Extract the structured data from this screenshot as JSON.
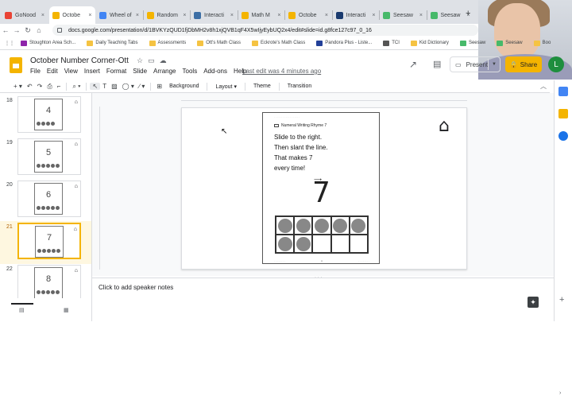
{
  "tabs": [
    {
      "label": "GoNood",
      "favicon": "#e94335",
      "active": false
    },
    {
      "label": "Octobe",
      "favicon": "#f4b400",
      "active": true
    },
    {
      "label": "Wheel of",
      "favicon": "#4285f4",
      "active": false
    },
    {
      "label": "Random",
      "favicon": "#f4b400",
      "active": false
    },
    {
      "label": "Interacti",
      "favicon": "#3c6ea5",
      "active": false
    },
    {
      "label": "Math M",
      "favicon": "#f4b400",
      "active": false
    },
    {
      "label": "Octobe",
      "favicon": "#f4b400",
      "active": false
    },
    {
      "label": "Interacti",
      "favicon": "#1a3a6e",
      "active": false
    },
    {
      "label": "Seesaw",
      "favicon": "#47b96a",
      "active": false
    },
    {
      "label": "Seesaw",
      "favicon": "#47b96a",
      "active": false
    }
  ],
  "close_glyph": "×",
  "new_tab_glyph": "+",
  "address": {
    "url": "docs.google.com/presentation/d/1BVKYzQUD1fjDbMH2v8h1xjQVB1qF4X5wIjyEybUQ2x4/edit#slide=id.g8fce127c97_0_16"
  },
  "bookmarks": [
    {
      "label": "Stoughton Area Sch...",
      "color": "#8e24aa"
    },
    {
      "label": "Daily Teaching Tabs",
      "color": "#f5c342"
    },
    {
      "label": "Assessments",
      "color": "#f5c342"
    },
    {
      "label": "Ott's Math Class",
      "color": "#f5c342"
    },
    {
      "label": "Eckrote's Math Class",
      "color": "#f5c342"
    },
    {
      "label": "Pandora Plus - Liste...",
      "color": "#224099"
    },
    {
      "label": "TCI",
      "color": "#555555"
    },
    {
      "label": "Kid Dictionary",
      "color": "#f5c342"
    },
    {
      "label": "Seesaw",
      "color": "#47b96a"
    },
    {
      "label": "Seesaw",
      "color": "#47b96a"
    },
    {
      "label": "Boo",
      "color": "#f5c342"
    }
  ],
  "doc": {
    "title": "October Number Corner-Ott",
    "last_edit": "Last edit was 4 minutes ago"
  },
  "menu": [
    "File",
    "Edit",
    "View",
    "Insert",
    "Format",
    "Slide",
    "Arrange",
    "Tools",
    "Add-ons",
    "Help"
  ],
  "header": {
    "present_label": "Present",
    "share_label": "Share",
    "avatar_letter": "L"
  },
  "toolbar": {
    "background_label": "Background",
    "layout_label": "Layout",
    "theme_label": "Theme",
    "transition_label": "Transition"
  },
  "slides": [
    {
      "number": "18",
      "digit": "4",
      "dots": 4,
      "selected": false
    },
    {
      "number": "19",
      "digit": "5",
      "dots": 5,
      "selected": false
    },
    {
      "number": "20",
      "digit": "6",
      "dots": 6,
      "selected": false
    },
    {
      "number": "21",
      "digit": "7",
      "dots": 7,
      "selected": true
    },
    {
      "number": "22",
      "digit": "8",
      "dots": 8,
      "selected": false
    }
  ],
  "page": {
    "title": "Numeral Writing Rhyme 7",
    "rhyme": [
      "Slide to the right.",
      "Then slant the line.",
      "That makes 7",
      "every time!"
    ],
    "numeral": "7",
    "filled_dots": 7
  },
  "notes": {
    "placeholder": "Click to add speaker notes"
  }
}
